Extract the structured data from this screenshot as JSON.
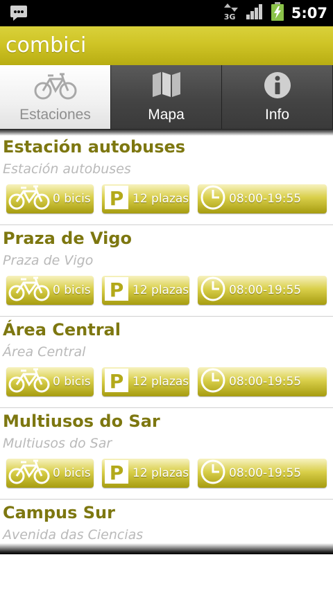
{
  "status_bar": {
    "time": "5:07",
    "network": "3G",
    "icons": [
      "message-icon",
      "network-3g-icon",
      "signal-icon",
      "battery-charging-icon"
    ]
  },
  "app": {
    "title": "combici",
    "accent": "#cfc426",
    "text_accent": "#7d7710"
  },
  "tabs": [
    {
      "label": "Estaciones",
      "icon": "bicycle-icon",
      "active": true
    },
    {
      "label": "Mapa",
      "icon": "map-icon",
      "active": false
    },
    {
      "label": "Info",
      "icon": "info-icon",
      "active": false
    }
  ],
  "stations": [
    {
      "name": "Estación autobuses",
      "address": "Estación autobuses",
      "bikes": "0 bicis",
      "slots": "12 plazas",
      "hours": "08:00-19:55"
    },
    {
      "name": "Praza de Vigo",
      "address": "Praza de Vigo",
      "bikes": "0 bicis",
      "slots": "12 plazas",
      "hours": "08:00-19:55"
    },
    {
      "name": "Área Central",
      "address": "Área Central",
      "bikes": "0 bicis",
      "slots": "12 plazas",
      "hours": "08:00-19:55"
    },
    {
      "name": "Multiusos do Sar",
      "address": "Multiusos do Sar",
      "bikes": "0 bicis",
      "slots": "12 plazas",
      "hours": "08:00-19:55"
    },
    {
      "name": "Campus Sur",
      "address": "Avenida das Ciencias",
      "bikes": "",
      "slots": "",
      "hours": ""
    }
  ]
}
